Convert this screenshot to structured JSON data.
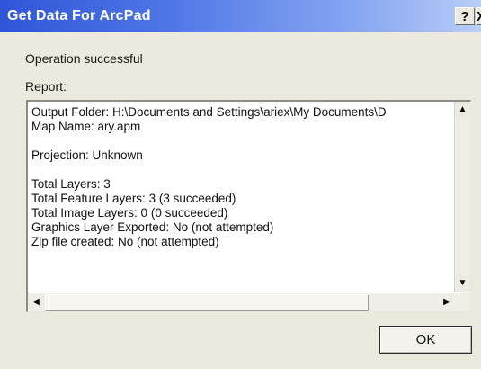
{
  "window": {
    "title": "Get Data For ArcPad",
    "help_label": "?",
    "close_label": "X"
  },
  "status": {
    "message": "Operation successful"
  },
  "report": {
    "label": "Report:",
    "lines": [
      "Output Folder: H:\\Documents and Settings\\ariex\\My Documents\\D",
      "Map Name: ary.apm",
      "",
      "Projection: Unknown",
      "",
      "Total Layers: 3",
      "Total Feature Layers: 3  (3 succeeded)",
      "Total Image Layers: 0  (0 succeeded)",
      "Graphics Layer Exported: No (not attempted)",
      "Zip file created: No (not attempted)"
    ]
  },
  "scrollbars": {
    "up_icon": "▲",
    "down_icon": "▼",
    "left_icon": "◀",
    "right_icon": "▶"
  },
  "buttons": {
    "ok_label": "OK"
  }
}
